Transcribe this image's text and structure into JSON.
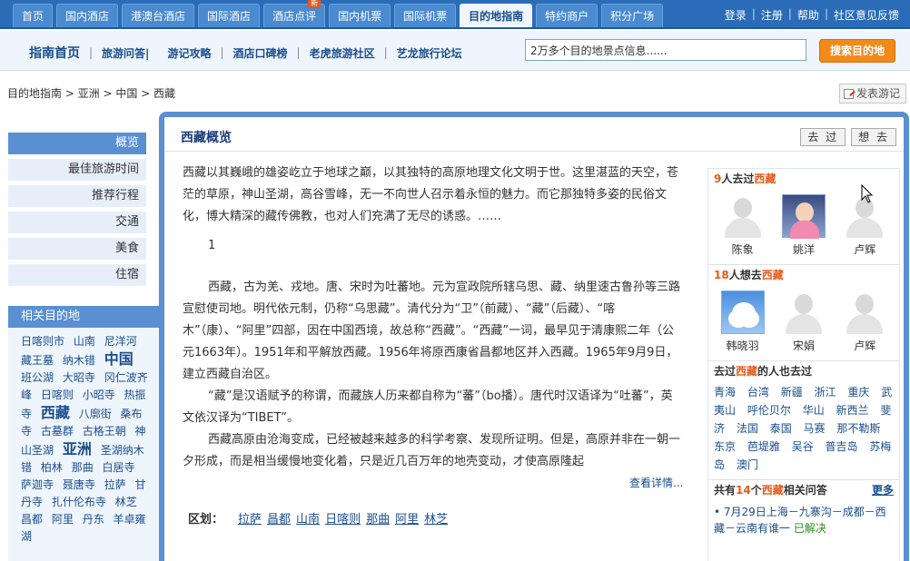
{
  "topnav": {
    "tabs": [
      {
        "label": "首页"
      },
      {
        "label": "国内酒店"
      },
      {
        "label": "港澳台酒店"
      },
      {
        "label": "国际酒店"
      },
      {
        "label": "酒店点评",
        "badge": "新"
      },
      {
        "label": "国内机票"
      },
      {
        "label": "国际机票"
      },
      {
        "label": "目的地指南",
        "active": true
      },
      {
        "label": "特约商户"
      },
      {
        "label": "积分广场"
      }
    ],
    "links": [
      "登录",
      "注册",
      "帮助",
      "社区意见反馈"
    ]
  },
  "subnav": {
    "home": "指南首页",
    "links": [
      "旅游问答|",
      "游记攻略",
      "酒店口碑榜",
      "老虎旅游社区",
      "艺龙旅行论坛"
    ],
    "search_value": "2万多个目的地景点信息......",
    "search_button": "搜索目的地"
  },
  "breadcrumb": "目的地指南 > 亚洲 > 中国 > 西藏",
  "post_button": "发表游记",
  "sidebar": {
    "title": "概览",
    "items": [
      "最佳旅游时间",
      "推荐行程",
      "交通",
      "美食",
      "住宿"
    ]
  },
  "related": {
    "title": "相关目的地",
    "tags": [
      {
        "t": "日喀则市"
      },
      {
        "t": "山南"
      },
      {
        "t": "尼洋河"
      },
      {
        "t": "藏王墓"
      },
      {
        "t": "纳木错"
      },
      {
        "t": "中国",
        "big": true
      },
      {
        "t": "班公湖"
      },
      {
        "t": "大昭寺"
      },
      {
        "t": "冈仁波齐峰"
      },
      {
        "t": "日喀则"
      },
      {
        "t": "小昭寺"
      },
      {
        "t": "热振寺"
      },
      {
        "t": "西藏",
        "big": true
      },
      {
        "t": "八廓街"
      },
      {
        "t": "桑布寺"
      },
      {
        "t": "古墓群"
      },
      {
        "t": "古格王朝"
      },
      {
        "t": "神山圣湖"
      },
      {
        "t": "亚洲",
        "big": true
      },
      {
        "t": "圣湖纳木错"
      },
      {
        "t": "柏林"
      },
      {
        "t": "那曲"
      },
      {
        "t": "白居寺"
      },
      {
        "t": "萨迦寺"
      },
      {
        "t": "聂唐寺"
      },
      {
        "t": "拉萨"
      },
      {
        "t": "甘丹寺"
      },
      {
        "t": "扎什伦布寺"
      },
      {
        "t": "林芝"
      },
      {
        "t": "昌都"
      },
      {
        "t": "阿里"
      },
      {
        "t": "丹东"
      },
      {
        "t": "羊卓雍湖"
      }
    ]
  },
  "main": {
    "title": "西藏概览",
    "btn_been": "去 过",
    "btn_want": "想 去",
    "intro": "西藏以其巍峨的雄姿屹立于地球之巅，以其独特的高原地理文化文明于世。这里湛蓝的天空，苍茫的草原，神山圣湖，高谷雪峰，无一不向世人召示着永恒的魅力。而它那独特多姿的民俗文化，博大精深的藏传佛教，也对人们充满了无尽的诱惑。……",
    "num": "1",
    "para1": "西藏，古为羌、戎地。唐、宋时为吐蕃地。元为宣政院所辖乌思、藏、纳里速古鲁孙等三路宣慰使司地。明代依元制，仍称“乌思藏”。清代分为“卫”（前藏）、“藏”（后藏）、“喀木”（康）、“阿里”四部，因在中国西境，故总称“西藏”。“西藏”一词，最早见于清康熙二年（公元1663年）。1951年和平解放西藏。1956年将原西康省昌都地区并入西藏。1965年9月9日，建立西藏自治区。",
    "para2": "“藏”是汉语赋予的称谓，而藏族人历来都自称为“蕃”（bo播）。唐代时汉语译为“吐蕃”，英文依汉译为“TIBET”。",
    "para3": "西藏高原由沧海变成，已经被越来越多的科学考察、发现所证明。但是，高原并非在一朝一夕形成，而是相当缓慢地变化着，只是近几百万年的地壳变动，才使高原隆起",
    "more": "查看详情...",
    "regions_label": "区划：",
    "regions": [
      "拉萨",
      "昌都",
      "山南",
      "日喀则",
      "那曲",
      "阿里",
      "林芝"
    ]
  },
  "right": {
    "been": {
      "count": "9",
      "mid": "人去过",
      "place": "西藏",
      "users": [
        {
          "name": "陈象",
          "pic": "silhouette"
        },
        {
          "name": "姚洋",
          "pic": "photo-girl"
        },
        {
          "name": "卢辉",
          "pic": "silhouette"
        }
      ]
    },
    "want": {
      "count": "18",
      "mid": "人想去",
      "place": "西藏",
      "users": [
        {
          "name": "韩晓羽",
          "pic": "photo-sky"
        },
        {
          "name": "宋娟",
          "pic": "silhouette"
        },
        {
          "name": "卢辉",
          "pic": "silhouette"
        }
      ]
    },
    "also": {
      "pre": "去过",
      "place": "西藏",
      "post": "的人也去过",
      "cities": [
        "青海",
        "台湾",
        "新疆",
        "浙江",
        "重庆",
        "武夷山",
        "呼伦贝尔",
        "华山",
        "新西兰",
        "斐济",
        "法国",
        "泰国",
        "马赛",
        "那不勒斯",
        "东京",
        "芭堤雅",
        "吴谷",
        "普吉岛",
        "苏梅岛",
        "澳门"
      ]
    },
    "qa": {
      "pre": "共有",
      "count": "14",
      "mid": "个",
      "place": "西藏",
      "post": "相关问答",
      "more": "更多",
      "item": "7月29日上海－九寨沟－成都－西藏－云南有谁一",
      "status": "已解决"
    }
  },
  "colors": {
    "nav": "#2a6cb8",
    "accent": "#e55a1a",
    "link": "#1a4d8c",
    "button": "#f2891a"
  }
}
